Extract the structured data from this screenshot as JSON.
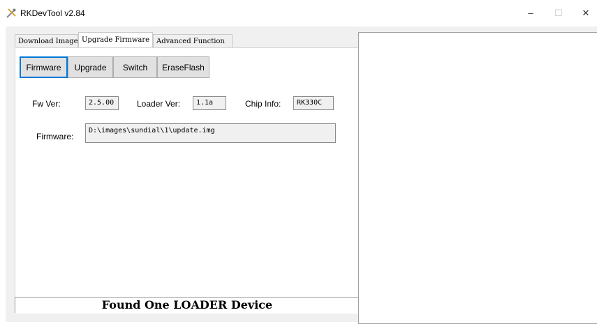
{
  "window": {
    "title": "RKDevTool v2.84",
    "minimize_glyph": "–",
    "maximize_glyph": "☐",
    "close_glyph": "✕"
  },
  "tabs": [
    {
      "label": "Download Image"
    },
    {
      "label": "Upgrade Firmware"
    },
    {
      "label": "Advanced Function"
    }
  ],
  "buttons": {
    "firmware": "Firmware",
    "upgrade": "Upgrade",
    "switch": "Switch",
    "erase_flash": "EraseFlash"
  },
  "info": {
    "fw_ver_label": "Fw Ver:",
    "fw_ver_value": "2.5.00",
    "loader_ver_label": "Loader Ver:",
    "loader_ver_value": "1.1a",
    "chip_info_label": "Chip Info:",
    "chip_info_value": "RK330C",
    "firmware_label": "Firmware:",
    "firmware_path": "D:\\images\\sundial\\1\\update.img"
  },
  "status": {
    "text": "Found One LOADER Device"
  },
  "colors": {
    "focus_border": "#0078d7",
    "button_face": "#e1e1e1",
    "window_bg": "#f0f0f0"
  }
}
